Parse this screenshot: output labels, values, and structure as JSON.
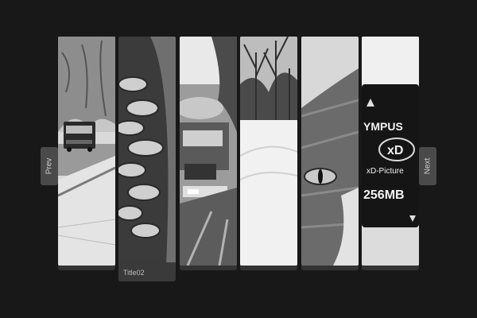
{
  "gallery": {
    "prev_label": "Prev",
    "next_label": "Next",
    "active_title": "Title02",
    "slides": [
      {
        "icon": "school-bus-snow-image"
      },
      {
        "icon": "pine-cone-image"
      },
      {
        "icon": "truck-image"
      },
      {
        "icon": "snowy-trees-image"
      },
      {
        "icon": "cat-eye-image"
      },
      {
        "icon": "memory-card-image",
        "card_brand": "YMPUS",
        "card_type": "xD-Picture",
        "card_logo": "xD",
        "card_size": "256MB"
      }
    ]
  }
}
